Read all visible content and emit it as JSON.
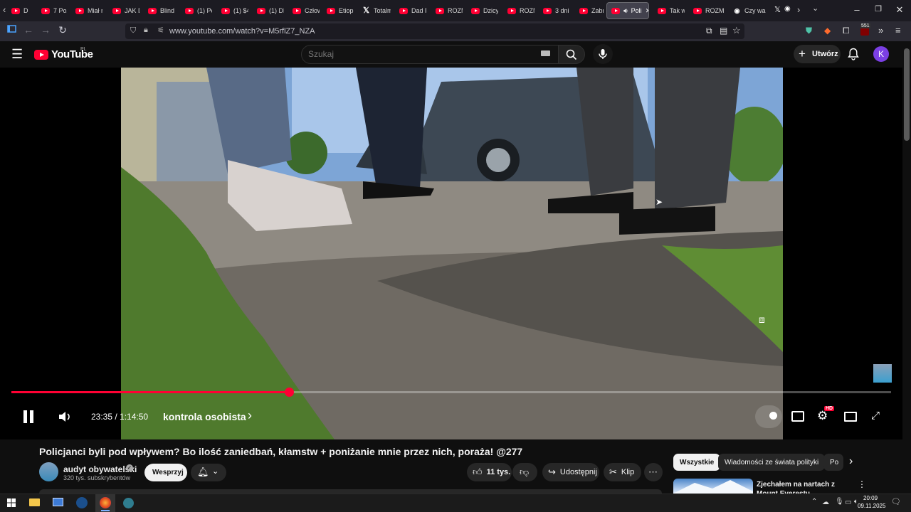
{
  "browser": {
    "tabs": [
      {
        "label": "D",
        "icon": "youtube-icon"
      },
      {
        "label": "7 Poz",
        "icon": "youtube-icon"
      },
      {
        "label": "Miał r",
        "icon": "youtube-icon"
      },
      {
        "label": "JAK D",
        "icon": "youtube-icon"
      },
      {
        "label": "Blind",
        "icon": "youtube-icon"
      },
      {
        "label": "(1) Pę",
        "icon": "youtube-icon"
      },
      {
        "label": "(1) $4",
        "icon": "youtube-icon"
      },
      {
        "label": "(1) DL",
        "icon": "youtube-icon"
      },
      {
        "label": "Człow",
        "icon": "youtube-icon"
      },
      {
        "label": "Etiopi",
        "icon": "youtube-icon"
      },
      {
        "label": "Totalm",
        "icon": "x-icon"
      },
      {
        "label": "Dad P",
        "icon": "youtube-icon"
      },
      {
        "label": "ROZM",
        "icon": "youtube-icon"
      },
      {
        "label": "Dzicy",
        "icon": "youtube-icon"
      },
      {
        "label": "ROZM",
        "icon": "youtube-icon"
      },
      {
        "label": "3 dni i",
        "icon": "youtube-icon"
      },
      {
        "label": "Zabra",
        "icon": "youtube-icon"
      },
      {
        "label": "Poli",
        "icon": "youtube-icon",
        "active": true
      },
      {
        "label": "Tak wy",
        "icon": "youtube-icon"
      },
      {
        "label": "ROZM",
        "icon": "youtube-icon"
      },
      {
        "label": "Czy wa",
        "icon": "tab-icon"
      }
    ],
    "url": "www.youtube.com/watch?v=M5rflZ7_NZA",
    "extension_badge": "551"
  },
  "youtube": {
    "logo_text": "YouTube",
    "logo_region": "PL",
    "search_placeholder": "Szukaj",
    "create_label": "Utwórz",
    "avatar_letter": "K",
    "accent_color": "#ff0033"
  },
  "player": {
    "current_time": "23:35",
    "duration": "1:14:50",
    "time_display": "23:35 / 1:14:50",
    "chapter": "kontrola osobista",
    "progress_fraction": 0.3155,
    "hd_badge": "HD"
  },
  "video": {
    "title": "Policjanci byli pod wpływem? Bo ilość zaniedbań, kłamstw + poniżanie mnie przez nich, poraża! @277",
    "channel_name": "audyt obywatelski",
    "subscribers": "320 tys. subskrybentów",
    "support_label": "Wesprzyj",
    "likes": "11 tys.",
    "share_label": "Udostępnij",
    "clip_label": "Klip"
  },
  "sidebar": {
    "chips": [
      "Wszystkie",
      "Wiadomości ze świata polityki",
      "Po"
    ],
    "recommended_title": "Zjechałem na nartach z Mount Everestu"
  },
  "taskbar": {
    "time": "20:09",
    "date": "09.11.2025"
  }
}
